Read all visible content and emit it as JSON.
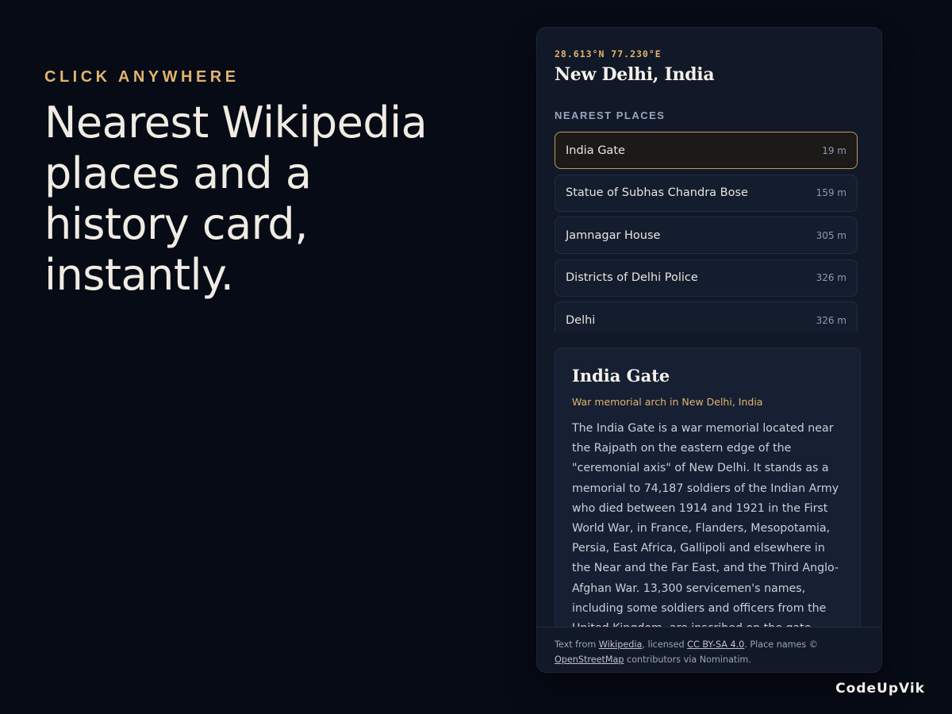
{
  "hero": {
    "eyebrow": "CLICK ANYWHERE",
    "headline_line1": "Nearest Wikipedia",
    "headline_line2": "places and a",
    "headline_line3": "history card,",
    "headline_line4": "instantly."
  },
  "panel": {
    "coords": "28.613°N 77.230°E",
    "location": "New Delhi, India",
    "section_title": "NEAREST PLACES",
    "places": [
      {
        "name": "India Gate",
        "distance": "19 m",
        "active": true
      },
      {
        "name": "Statue of Subhas Chandra Bose",
        "distance": "159 m",
        "active": false
      },
      {
        "name": "Jamnagar House",
        "distance": "305 m",
        "active": false
      },
      {
        "name": "Districts of Delhi Police",
        "distance": "326 m",
        "active": false
      },
      {
        "name": "Delhi",
        "distance": "326 m",
        "active": false
      }
    ],
    "card": {
      "title": "India Gate",
      "subtitle": "War memorial arch in New Delhi, India",
      "body": "The India Gate is a war memorial located near the Rajpath on the eastern edge of the \"ceremonial axis\" of New Delhi. It stands as a memorial to 74,187 soldiers of the Indian Army who died between 1914 and 1921 in the First World War, in France, Flanders, Mesopotamia, Persia, East Africa, Gallipoli and elsewhere in the Near and the Far East, and the Third Anglo-Afghan War. 13,300 servicemen's names, including some soldiers and officers from the United Kingdom, are inscribed on the gate."
    },
    "footer": {
      "text1": "Text from ",
      "link_wikipedia": "Wikipedia",
      "text2": ", licensed ",
      "link_license": "CC BY-SA 4.0",
      "text3": ". Place names © ",
      "link_osm": "OpenStreetMap",
      "text4": " contributors via Nominatim."
    }
  },
  "brand": "CodeUpVik",
  "colors": {
    "background": "#070b16",
    "accent": "#e3b36c",
    "panel": "#111827",
    "active_border": "#c29b5d"
  }
}
